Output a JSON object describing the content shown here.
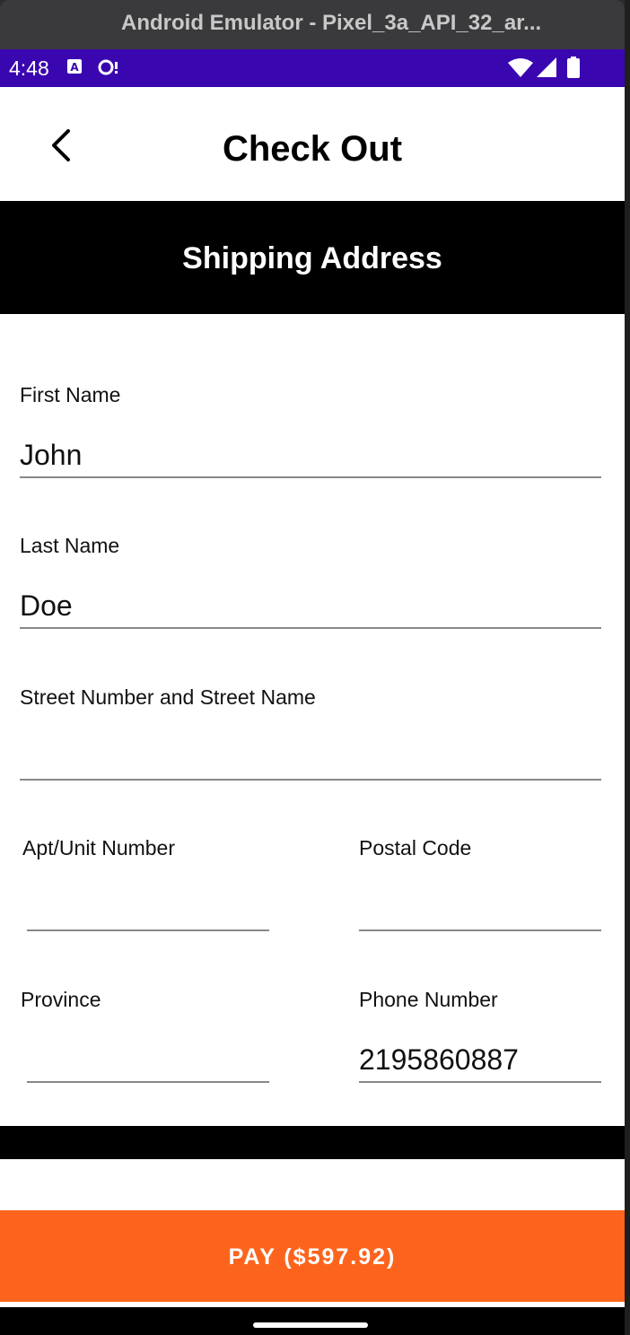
{
  "window": {
    "title": "Android Emulator - Pixel_3a_API_32_ar..."
  },
  "status_bar": {
    "time": "4:48"
  },
  "app_bar": {
    "title": "Check Out"
  },
  "section": {
    "title": "Shipping Address"
  },
  "form": {
    "first_name": {
      "label": "First Name",
      "value": "John"
    },
    "last_name": {
      "label": "Last Name",
      "value": "Doe"
    },
    "street": {
      "label": "Street Number and Street Name",
      "value": ""
    },
    "apt": {
      "label": "Apt/Unit Number",
      "value": ""
    },
    "postal": {
      "label": "Postal Code",
      "value": ""
    },
    "province": {
      "label": "Province",
      "value": ""
    },
    "phone": {
      "label": "Phone Number",
      "value": "2195860887"
    }
  },
  "pay_button": {
    "label": "PAY ($597.92)"
  },
  "colors": {
    "status_bar": "#3a06b0",
    "accent": "#fc641d",
    "header": "#000000"
  }
}
